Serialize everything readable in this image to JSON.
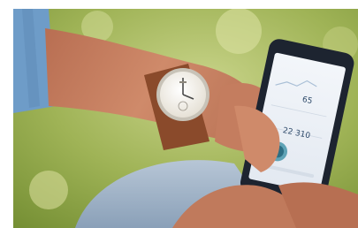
{
  "photo": {
    "description_tags": [
      "smartwatch",
      "smartphone",
      "activity-app"
    ],
    "phone_screen": {
      "readout_top": "65",
      "readout_middle": "22 310"
    },
    "colors": {
      "grass_light": "#b9c77a",
      "grass_dark": "#6f8a2f",
      "skin": "#c98466",
      "sleeve": "#6e9cc8",
      "jeans": "#9fb3c9",
      "phone_body": "#1d2430",
      "watch_face": "#f4f1ea",
      "strap": "#8a4a2b"
    }
  }
}
